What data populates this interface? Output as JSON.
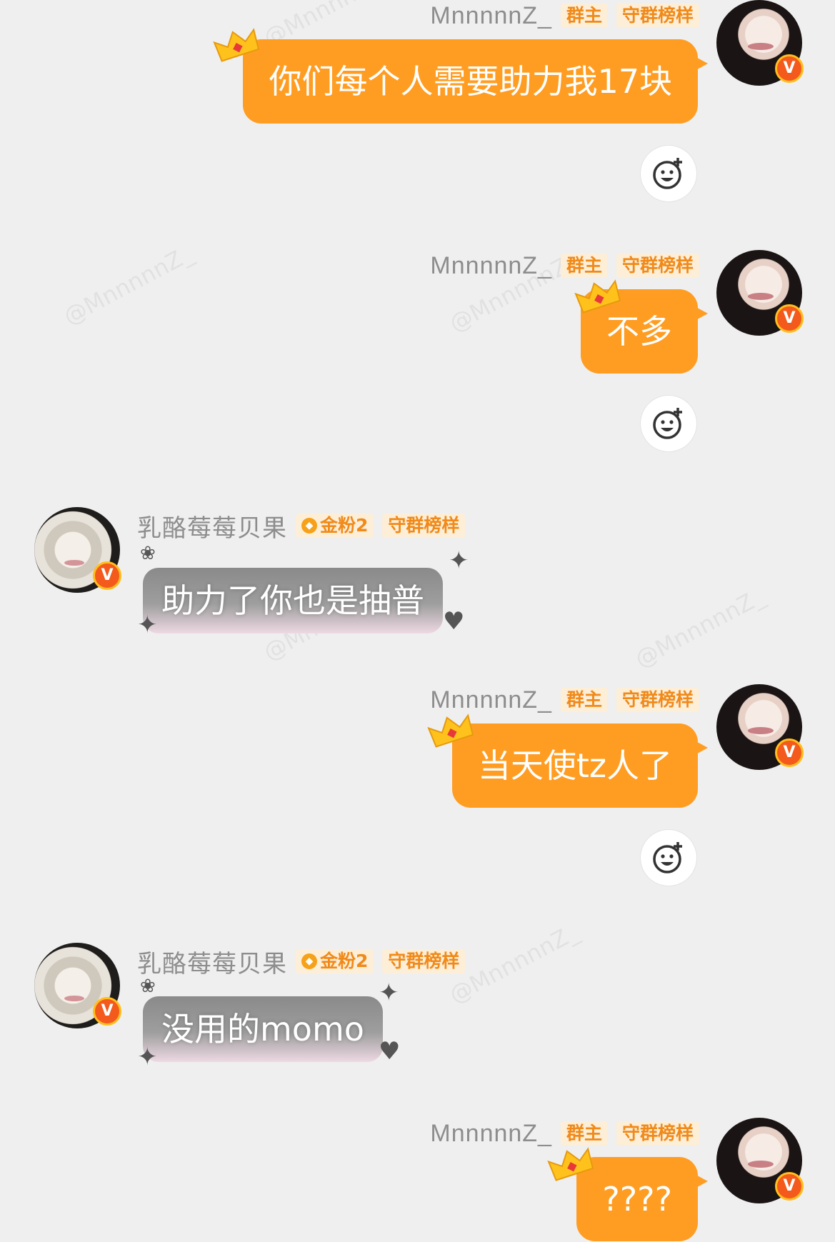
{
  "watermark": "@MnnnnnZ_",
  "messages": [
    {
      "sender": "owner",
      "name": "MnnnnnZ_",
      "tags": [
        "群主",
        "守群榜样"
      ],
      "text": "你们每个人需要助力我17块",
      "has_reaction": true
    },
    {
      "sender": "owner",
      "name": "MnnnnnZ_",
      "tags": [
        "群主",
        "守群榜样"
      ],
      "text": "不多",
      "has_reaction": true
    },
    {
      "sender": "fan",
      "name": "乳酪莓莓贝果",
      "tags": [
        "金粉2",
        "守群榜样"
      ],
      "text": "助力了你也是抽普",
      "has_reaction": false
    },
    {
      "sender": "owner",
      "name": "MnnnnnZ_",
      "tags": [
        "群主",
        "守群榜样"
      ],
      "text": "当天使tz人了",
      "has_reaction": true
    },
    {
      "sender": "fan",
      "name": "乳酪莓莓贝果",
      "tags": [
        "金粉2",
        "守群榜样"
      ],
      "text": "没用的momo",
      "has_reaction": false
    },
    {
      "sender": "owner",
      "name": "MnnnnnZ_",
      "tags": [
        "群主",
        "守群榜样"
      ],
      "text": "????",
      "has_reaction": false
    }
  ],
  "colors": {
    "bubble_owner": "#ff9d22",
    "tag_bg": "#fdeed7",
    "tag_text": "#f08a1a",
    "badge": "#f35a1c"
  },
  "icons": {
    "verified": "V",
    "reaction": "add-reaction-icon",
    "crown": "crown-icon"
  }
}
